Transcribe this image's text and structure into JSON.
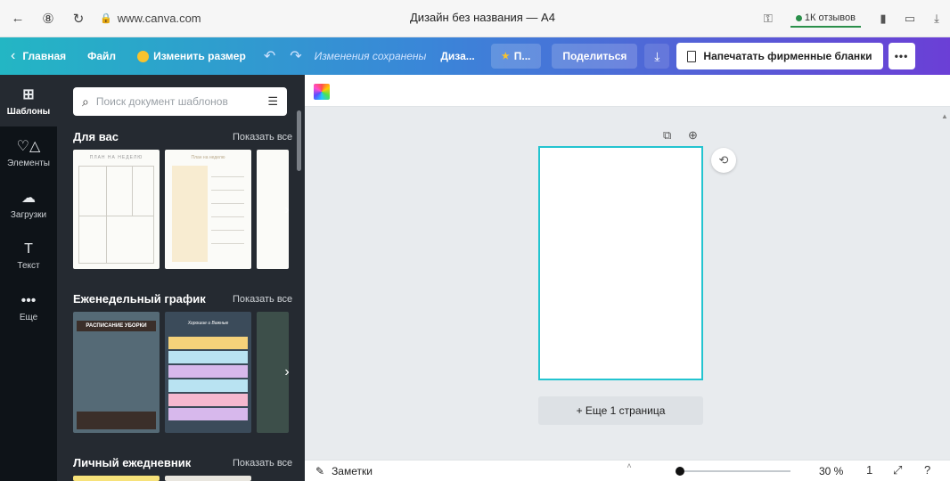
{
  "browser": {
    "back_icon": "←",
    "profile_icon": "⑧",
    "reload_icon": "↻",
    "lock_icon": "🔒",
    "url": "www.canva.com",
    "title": "Дизайн без названия — A4",
    "reviews": "1К отзывов"
  },
  "toolbar": {
    "home": "Главная",
    "file": "Файл",
    "resize": "Изменить размер",
    "saved": "Изменения сохранены",
    "design_name": "Диза...",
    "pro_label": "П...",
    "share": "Поделиться",
    "print": "Напечатать фирменные бланки",
    "more": "•••"
  },
  "rail": [
    {
      "label": "Шаблоны",
      "icon": "⊞"
    },
    {
      "label": "Элементы",
      "icon": "♡△"
    },
    {
      "label": "Загрузки",
      "icon": "☁"
    },
    {
      "label": "Текст",
      "icon": "T"
    },
    {
      "label": "Еще",
      "icon": "•••"
    }
  ],
  "panel": {
    "search_placeholder": "Поиск документ шаблонов",
    "sections": [
      {
        "title": "Для вас",
        "show_all": "Показать все"
      },
      {
        "title": "Еженедельный график",
        "show_all": "Показать все"
      },
      {
        "title": "Личный ежедневник",
        "show_all": "Показать все"
      }
    ],
    "thumb_labels": {
      "plan_week_1": "ПЛАН НА НЕДЕЛЮ",
      "plan_week_2": "План на неделю",
      "cleaning": "РАСПИСАНИЕ УБОРКИ",
      "days": "Хорошие и Важные"
    }
  },
  "editor": {
    "add_page": "+ Еще 1 страница"
  },
  "bottom": {
    "notes": "Заметки",
    "zoom": "30 %",
    "zoom_fraction": 0.0,
    "page_count": "1"
  },
  "colors": {
    "accent": "#23c4d0",
    "toolbar_start": "#23b6c4",
    "toolbar_end": "#6b3fd6",
    "rail_bg": "#0e1318",
    "panel_bg": "#252a31"
  }
}
